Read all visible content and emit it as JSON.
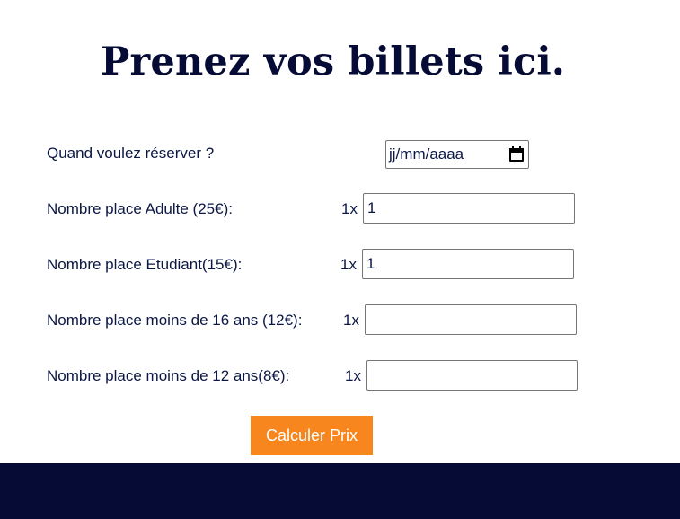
{
  "title": "Prenez vos billets ici.",
  "form": {
    "date": {
      "label": "Quand voulez réserver ?",
      "placeholder": "jj/mm/aaaa",
      "icon": "calendar-icon"
    },
    "rows": [
      {
        "label": "Nombre place Adulte (25€):",
        "multiplier": "1x",
        "value": "1"
      },
      {
        "label": "Nombre place Etudiant(15€):",
        "multiplier": "1x",
        "value": "1"
      },
      {
        "label": "Nombre place moins de 16 ans (12€):",
        "multiplier": "1x",
        "value": ""
      },
      {
        "label": "Nombre place moins de 12 ans(8€):",
        "multiplier": "1x",
        "value": ""
      }
    ],
    "submit_label": "Calculer Prix"
  },
  "colors": {
    "title": "#050b35",
    "text": "#0b1744",
    "button": "#f7861f",
    "footer": "#050b35"
  }
}
